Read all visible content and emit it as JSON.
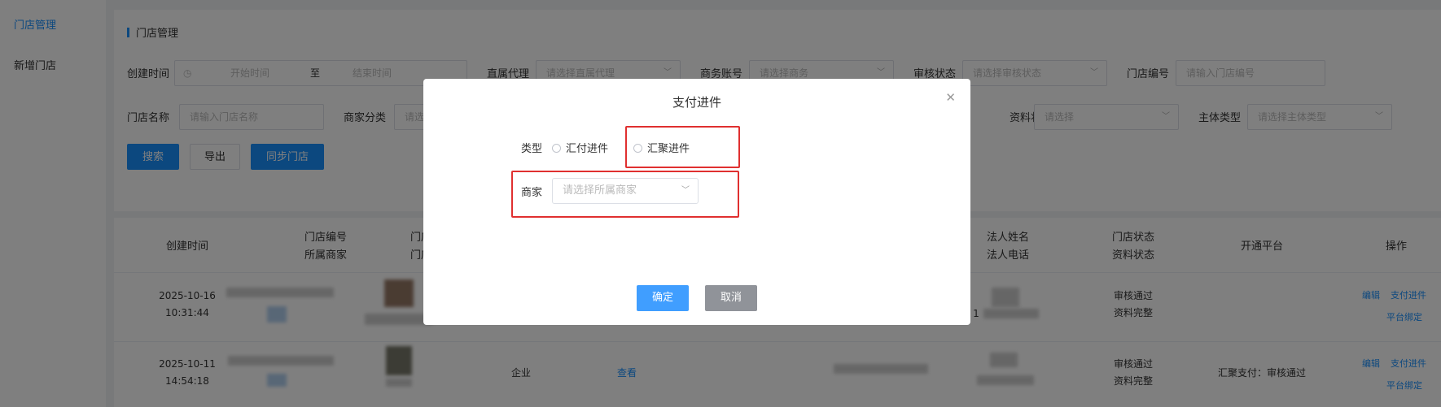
{
  "sidebar": {
    "items": [
      {
        "label": "门店管理",
        "active": true
      },
      {
        "label": "新增门店",
        "active": false
      }
    ]
  },
  "filter": {
    "title": "门店管理",
    "create_time": {
      "label": "创建时间",
      "start_placeholder": "开始时间",
      "separator": "至",
      "end_placeholder": "结束时间"
    },
    "direct_agent": {
      "label": "直属代理",
      "placeholder": "请选择直属代理"
    },
    "business_account": {
      "label": "商务账号",
      "placeholder": "请选择商务"
    },
    "audit_status": {
      "label": "审核状态",
      "placeholder": "请选择审核状态"
    },
    "store_no": {
      "label": "门店编号",
      "placeholder": "请输入门店编号"
    },
    "store_name": {
      "label": "门店名称",
      "placeholder": "请输入门店名称"
    },
    "merchant_category": {
      "label": "商家分类",
      "placeholder": "请选"
    },
    "material_status": {
      "label": "资料状态",
      "placeholder": "请选择"
    },
    "entity_type": {
      "label": "主体类型",
      "placeholder": "请选择主体类型"
    },
    "buttons": {
      "search": "搜索",
      "export": "导出",
      "sync": "同步门店"
    }
  },
  "table": {
    "headers": {
      "create_time": "创建时间",
      "store_no": "门店编号",
      "merchant": "所属商家",
      "store_head": "门店门头",
      "store_name": "门店名称",
      "legal_name": "法人姓名",
      "legal_phone": "法人电话",
      "store_status": "门店状态",
      "material_status": "资料状态",
      "platform": "开通平台",
      "ops": "操作"
    },
    "rows": [
      {
        "date": "2025-10-16",
        "time": "10:31:44",
        "store_status": "审核通过",
        "material_status": "资料完整",
        "entity": "",
        "view": "",
        "platform": "",
        "phone_prefix": "1",
        "edit": "编辑",
        "pay": "支付进件",
        "bind": "平台绑定"
      },
      {
        "date": "2025-10-11",
        "time": "14:54:18",
        "store_status": "审核通过",
        "material_status": "资料完整",
        "entity": "企业",
        "view": "查看",
        "platform": "汇聚支付：审核通过",
        "phone_prefix": "",
        "edit": "编辑",
        "pay": "支付进件",
        "bind": "平台绑定"
      }
    ]
  },
  "modal": {
    "title": "支付进件",
    "type_label": "类型",
    "options": [
      "汇付进件",
      "汇聚进件"
    ],
    "merchant_label": "商家",
    "merchant_placeholder": "请选择所属商家",
    "confirm": "确定",
    "cancel": "取消"
  },
  "colors": {
    "primary": "#1890ff",
    "highlight": "#e03030",
    "cancel": "#909399",
    "confirm": "#409eff"
  }
}
